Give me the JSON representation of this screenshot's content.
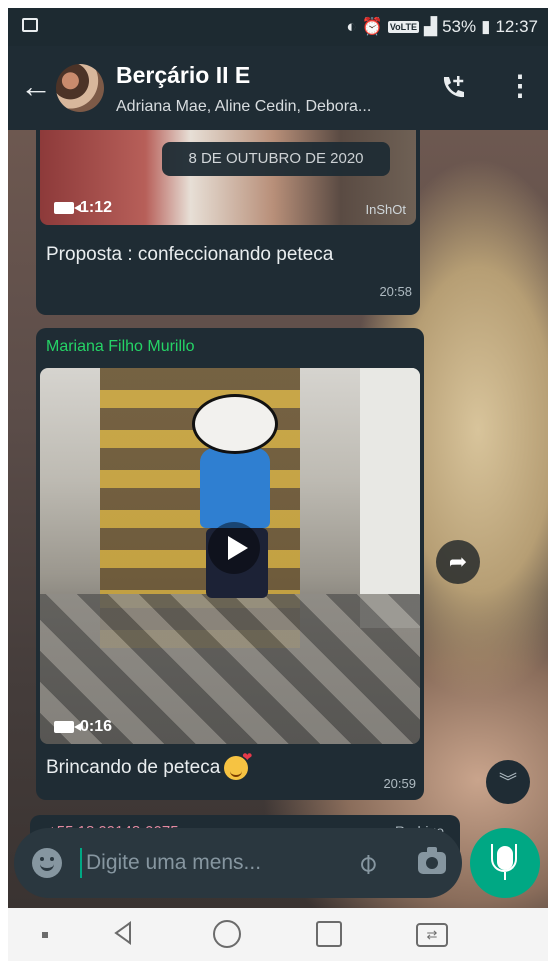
{
  "status_bar": {
    "volte_label": "VoLTE",
    "battery": "53%",
    "clock": "12:37",
    "icons": [
      "gallery-icon",
      "vibrate-icon",
      "alarm-icon",
      "signal-icon",
      "battery-icon"
    ]
  },
  "header": {
    "title": "Berçário II E",
    "subtitle": "Adriana Mae, Aline Cedin, Debora...",
    "icons": [
      "back-arrow-icon",
      "group-avatar",
      "add-call-icon",
      "more-menu-icon"
    ]
  },
  "chat": {
    "date_divider": "8 DE OUTUBRO DE 2020",
    "messages": [
      {
        "video_duration": "1:12",
        "watermark": "InShOt",
        "caption": "Proposta : confeccionando peteca",
        "time": "20:58"
      },
      {
        "sender": "Mariana Filho Murillo",
        "video_duration": "0:16",
        "caption": "Brincando de peteca",
        "time": "20:59"
      },
      {
        "sender_phone": "+55 18 99148-0075",
        "sender_nick": "Rodrigo"
      }
    ]
  },
  "composer": {
    "placeholder": "Digite uma mens..."
  },
  "colors": {
    "header_bg": "#1f2c34",
    "bubble_bg": "#1f2c34",
    "accent_green": "#00a884",
    "sender_name": "#25d366"
  }
}
